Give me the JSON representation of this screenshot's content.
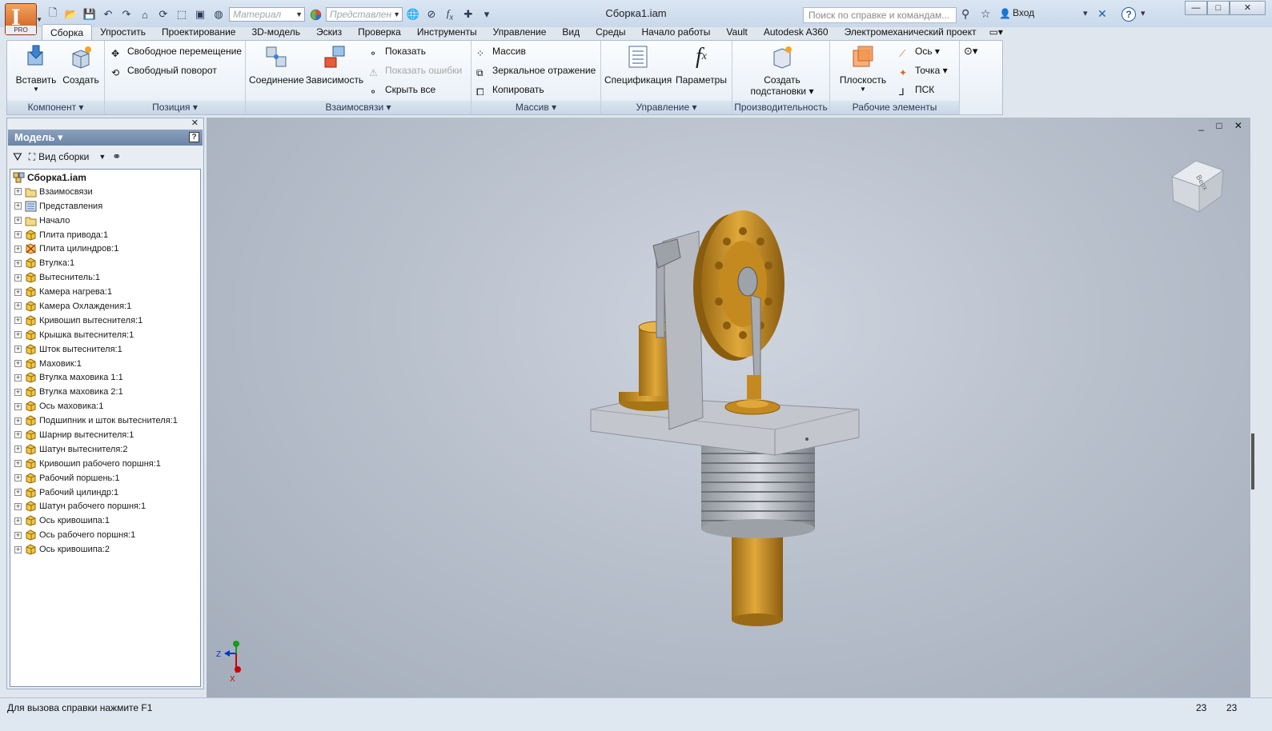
{
  "titlebar": {
    "window_title": "Сборка1.iam",
    "app_badge": "PRO",
    "app_letter": "I",
    "material_placeholder": "Материал",
    "representation_placeholder": "Представлен",
    "search_placeholder": "Поиск по справке и командам...",
    "login_label": "Вход",
    "minimize": "—",
    "maximize": "□",
    "close": "✕"
  },
  "tabs": [
    "Сборка",
    "Упростить",
    "Проектирование",
    "3D-модель",
    "Эскиз",
    "Проверка",
    "Инструменты",
    "Управление",
    "Вид",
    "Среды",
    "Начало работы",
    "Vault",
    "Autodesk A360",
    "Электромеханический проект"
  ],
  "ribbon": {
    "component": {
      "title": "Компонент ▾",
      "insert": "Вставить",
      "create": "Создать"
    },
    "position": {
      "title": "Позиция ▾",
      "free_move": "Свободное перемещение",
      "free_rotate": "Свободный поворот"
    },
    "relations": {
      "title": "Взаимосвязи ▾",
      "joint": "Соединение",
      "constraint": "Зависимость",
      "show": "Показать",
      "show_errors": "Показать ошибки",
      "hide_all": "Скрыть все"
    },
    "pattern": {
      "title": "Массив ▾",
      "pattern": "Массив",
      "mirror": "Зеркальное отражение",
      "copy": "Копировать"
    },
    "manage": {
      "title": "Управление ▾",
      "bom": "Спецификация",
      "params": "Параметры"
    },
    "productivity": {
      "title": "Производительность",
      "create_sub": "Создать",
      "create_sub2": "подстановки ▾"
    },
    "work": {
      "title": "Рабочие элементы",
      "plane": "Плоскость",
      "axis": "Ось ▾",
      "point": "Точка ▾",
      "ucs": "ПСК"
    }
  },
  "browser": {
    "title": "Модель ▾",
    "view_label": "Вид сборки",
    "close": "✕",
    "help": "?",
    "root": "Сборка1.iam",
    "items": [
      {
        "label": "Взаимосвязи",
        "icon": "folder"
      },
      {
        "label": "Представления",
        "icon": "representations"
      },
      {
        "label": "Начало",
        "icon": "folder"
      },
      {
        "label": "Плита привода:1",
        "icon": "part"
      },
      {
        "label": "Плита цилиндров:1",
        "icon": "part-grounded"
      },
      {
        "label": "Втулка:1",
        "icon": "part"
      },
      {
        "label": "Вытеснитель:1",
        "icon": "part"
      },
      {
        "label": "Камера нагрева:1",
        "icon": "part"
      },
      {
        "label": "Камера Охлаждения:1",
        "icon": "part"
      },
      {
        "label": "Кривошип вытеснителя:1",
        "icon": "part"
      },
      {
        "label": "Крышка вытеснителя:1",
        "icon": "part"
      },
      {
        "label": "Шток вытеснителя:1",
        "icon": "part"
      },
      {
        "label": "Маховик:1",
        "icon": "part"
      },
      {
        "label": "Втулка маховика 1:1",
        "icon": "part"
      },
      {
        "label": "Втулка маховика 2:1",
        "icon": "part"
      },
      {
        "label": "Ось маховика:1",
        "icon": "part"
      },
      {
        "label": "Подшипник и шток вытеснителя:1",
        "icon": "part"
      },
      {
        "label": "Шарнир вытеснителя:1",
        "icon": "part"
      },
      {
        "label": "Шатун вытеснителя:2",
        "icon": "part"
      },
      {
        "label": "Кривошип рабочего поршня:1",
        "icon": "part"
      },
      {
        "label": "Рабочий поршень:1",
        "icon": "part"
      },
      {
        "label": "Рабочий цилиндр:1",
        "icon": "part"
      },
      {
        "label": "Шатун рабочего поршня:1",
        "icon": "part"
      },
      {
        "label": "Ось кривошипа:1",
        "icon": "part"
      },
      {
        "label": "Ось рабочего поршня:1",
        "icon": "part"
      },
      {
        "label": "Ось кривошипа:2",
        "icon": "part"
      }
    ]
  },
  "viewport": {
    "viewcube_label": "Верх",
    "axis_x": "X",
    "axis_z": "Z",
    "controls": "_ □ ✕"
  },
  "status": {
    "text": "Для вызова справки нажмите F1",
    "count1": "23",
    "count2": "23"
  },
  "colors": {
    "brass": "#c8922a",
    "steel": "#b8bcc4",
    "accent": "#d9671e"
  }
}
